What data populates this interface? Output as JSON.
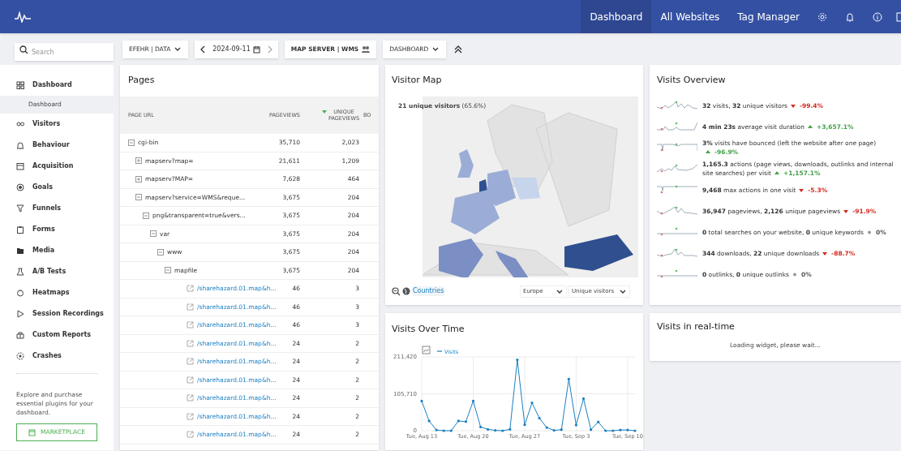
{
  "top_nav": {
    "items": [
      {
        "label": "Dashboard",
        "selected": true
      },
      {
        "label": "All Websites",
        "selected": false
      },
      {
        "label": "Tag Manager",
        "selected": false
      }
    ]
  },
  "toolbar": {
    "search": {
      "placeholder": "Search"
    },
    "site_selector": "EFEHR | DATA",
    "date": "2024-09-11",
    "segment": "MAP SERVER | WMS",
    "dashboard_selector": "DASHBOARD"
  },
  "sidebar": {
    "items": [
      {
        "label": "Dashboard",
        "children": [
          {
            "label": "Dashboard",
            "selected": true
          }
        ]
      },
      {
        "label": "Visitors"
      },
      {
        "label": "Behaviour"
      },
      {
        "label": "Acquisition"
      },
      {
        "label": "Goals"
      },
      {
        "label": "Funnels"
      },
      {
        "label": "Forms"
      },
      {
        "label": "Media"
      },
      {
        "label": "A/B Tests"
      },
      {
        "label": "Heatmaps"
      },
      {
        "label": "Session Recordings"
      },
      {
        "label": "Custom Reports"
      },
      {
        "label": "Crashes"
      }
    ],
    "promo": "Explore and purchase essential plugins for your dashboard.",
    "marketplace_button": "MARKETPLACE"
  },
  "pages": {
    "title": "Pages",
    "columns": [
      {
        "label": "PAGE URL",
        "sorted": false
      },
      {
        "label": "PAGEVIEWS",
        "sorted": false
      },
      {
        "label": "UNIQUE PAGEVIEWS",
        "sorted": true
      },
      {
        "label": "BO",
        "sorted": false
      }
    ],
    "rows": [
      {
        "kind": "folder",
        "label": "cgi-bin",
        "pageviews": "35,710",
        "unique": "2,023",
        "expanded": true,
        "children": [
          {
            "kind": "folder",
            "label": "mapserv?map=",
            "pageviews": "21,611",
            "unique": "1,209",
            "expanded": false
          },
          {
            "kind": "folder",
            "label": "mapserv?MAP=",
            "pageviews": "7,628",
            "unique": "464",
            "expanded": false
          },
          {
            "kind": "folder",
            "label": "mapserv?service=WMS&reque...",
            "pageviews": "3,675",
            "unique": "204",
            "expanded": true,
            "children": [
              {
                "kind": "folder",
                "label": "png&transparent=true&vers...",
                "pageviews": "3,675",
                "unique": "204",
                "expanded": true,
                "children": [
                  {
                    "kind": "folder",
                    "label": "var",
                    "pageviews": "3,675",
                    "unique": "204",
                    "expanded": true,
                    "children": [
                      {
                        "kind": "folder",
                        "label": "www",
                        "pageviews": "3,675",
                        "unique": "204",
                        "expanded": true,
                        "children": [
                          {
                            "kind": "folder",
                            "label": "mapfile",
                            "pageviews": "3,675",
                            "unique": "204",
                            "expanded": true,
                            "children": [
                              {
                                "kind": "link",
                                "label": "/sharehazard.01.map&h...",
                                "pageviews": "46",
                                "unique": "3"
                              },
                              {
                                "kind": "link",
                                "label": "/sharehazard.01.map&h...",
                                "pageviews": "46",
                                "unique": "3"
                              },
                              {
                                "kind": "link",
                                "label": "/sharehazard.01.map&h...",
                                "pageviews": "46",
                                "unique": "3"
                              },
                              {
                                "kind": "link",
                                "label": "/sharehazard.01.map&h...",
                                "pageviews": "24",
                                "unique": "2"
                              },
                              {
                                "kind": "link",
                                "label": "/sharehazard.01.map&h...",
                                "pageviews": "24",
                                "unique": "2"
                              },
                              {
                                "kind": "link",
                                "label": "/sharehazard.01.map&h...",
                                "pageviews": "24",
                                "unique": "2"
                              },
                              {
                                "kind": "link",
                                "label": "/sharehazard.01.map&h...",
                                "pageviews": "24",
                                "unique": "2"
                              },
                              {
                                "kind": "link",
                                "label": "/sharehazard.01.map&h...",
                                "pageviews": "24",
                                "unique": "2"
                              },
                              {
                                "kind": "link",
                                "label": "/sharehazard.01.map&h...",
                                "pageviews": "24",
                                "unique": "2"
                              }
                            ]
                          }
                        ]
                      }
                    ]
                  }
                ]
              }
            ]
          }
        ]
      }
    ]
  },
  "visitor_map": {
    "title": "Visitor Map",
    "summary": "**21 unique visitors** (65.6%)",
    "view_link": "Countries",
    "region_select": "Europe",
    "metric_select": "Unique visitors"
  },
  "visits_over_time": {
    "title": "Visits Over Time",
    "chart_data": {
      "type": "line",
      "categories": [
        "Tue, Aug 13",
        null,
        null,
        null,
        null,
        null,
        null,
        "Tue, Aug 20",
        null,
        null,
        null,
        null,
        null,
        null,
        "Tue, Aug 27",
        null,
        null,
        null,
        null,
        null,
        null,
        "Tue, Sep 3",
        null,
        null,
        null,
        null,
        null,
        null,
        "Tue, Sep 10",
        null
      ],
      "series": [
        {
          "name": "Visits",
          "color": "#1a7fc1",
          "values": [
            85000,
            28000,
            2000,
            0,
            0,
            28000,
            26000,
            85000,
            11000,
            4000,
            1000,
            0,
            4000,
            203000,
            17000,
            80000,
            36000,
            9000,
            1000,
            3000,
            148000,
            16000,
            92000,
            3000,
            25000,
            0,
            0,
            2000,
            2000,
            0
          ]
        }
      ],
      "yticks": [
        {
          "value": 0,
          "label": "0"
        },
        {
          "value": 105710,
          "label": "105,710"
        },
        {
          "value": 211420,
          "label": "211,420"
        }
      ],
      "ylim": [
        0,
        211420
      ],
      "grid": true
    }
  },
  "visits_overview": {
    "title": "Visits Overview",
    "items": [
      {
        "text": "**32** visits, **32** unique visitors",
        "change": "-99.4%",
        "kind": "bad"
      },
      {
        "text": "**4 min 23s** average visit duration",
        "change": "+3,657.1%",
        "kind": "good"
      },
      {
        "text": "**3%** visits have bounced (left the website after one page)",
        "change": "-96.9%",
        "kind": "good"
      },
      {
        "text": "**1,165.3** actions (page views, downloads, outlinks and internal site searches) per visit",
        "change": "+1,157.1%",
        "kind": "good"
      },
      {
        "text": "**9,468** max actions in one visit",
        "change": "-5.3%",
        "kind": "bad"
      },
      {
        "text": "**36,947** pageviews, **2,126** unique pageviews",
        "change": "-91.9%",
        "kind": "bad"
      },
      {
        "text": "**0** total searches on your website, **0** unique keywords",
        "change": "0%",
        "kind": "neutral"
      },
      {
        "text": "**344** downloads, **22** unique downloads",
        "change": "-88.7%",
        "kind": "bad"
      },
      {
        "text": "**0** outlinks, **0** unique outlinks",
        "change": "0%",
        "kind": "neutral"
      }
    ]
  },
  "realtime": {
    "title": "Visits in real-time",
    "message": "Loading widget, please wait..."
  }
}
